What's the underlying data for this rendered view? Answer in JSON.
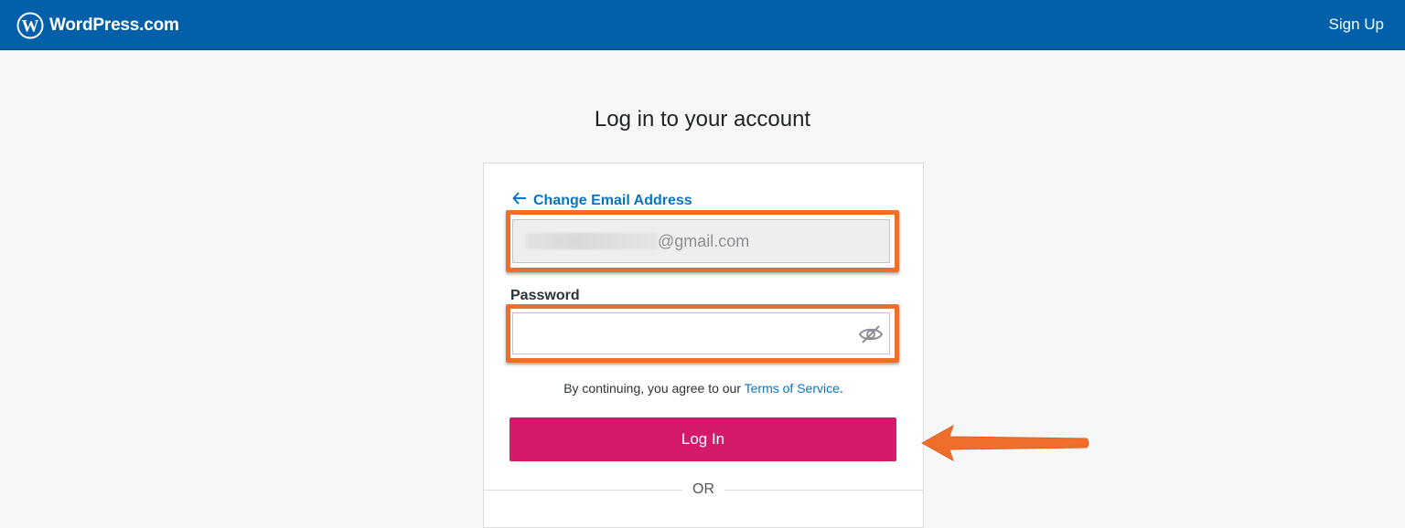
{
  "header": {
    "brand": "WordPress.com",
    "signup_label": "Sign Up",
    "logo_icon": "wordpress-logo-icon"
  },
  "page": {
    "title": "Log in to your account"
  },
  "login_form": {
    "back_link_label": "Change Email Address",
    "back_icon": "arrow-left-icon",
    "email_value": "@gmail.com",
    "password_label": "Password",
    "password_value": "",
    "password_visibility_icon": "eye-slash-icon",
    "terms_prefix": "By continuing, you agree to our ",
    "terms_link": "Terms of Service",
    "terms_suffix": ".",
    "submit_label": "Log In",
    "divider_label": "OR"
  },
  "colors": {
    "header_bg": "#0160a9",
    "link": "#0675c4",
    "primary_button": "#d61a6b",
    "annotation": "#f06e2b"
  }
}
